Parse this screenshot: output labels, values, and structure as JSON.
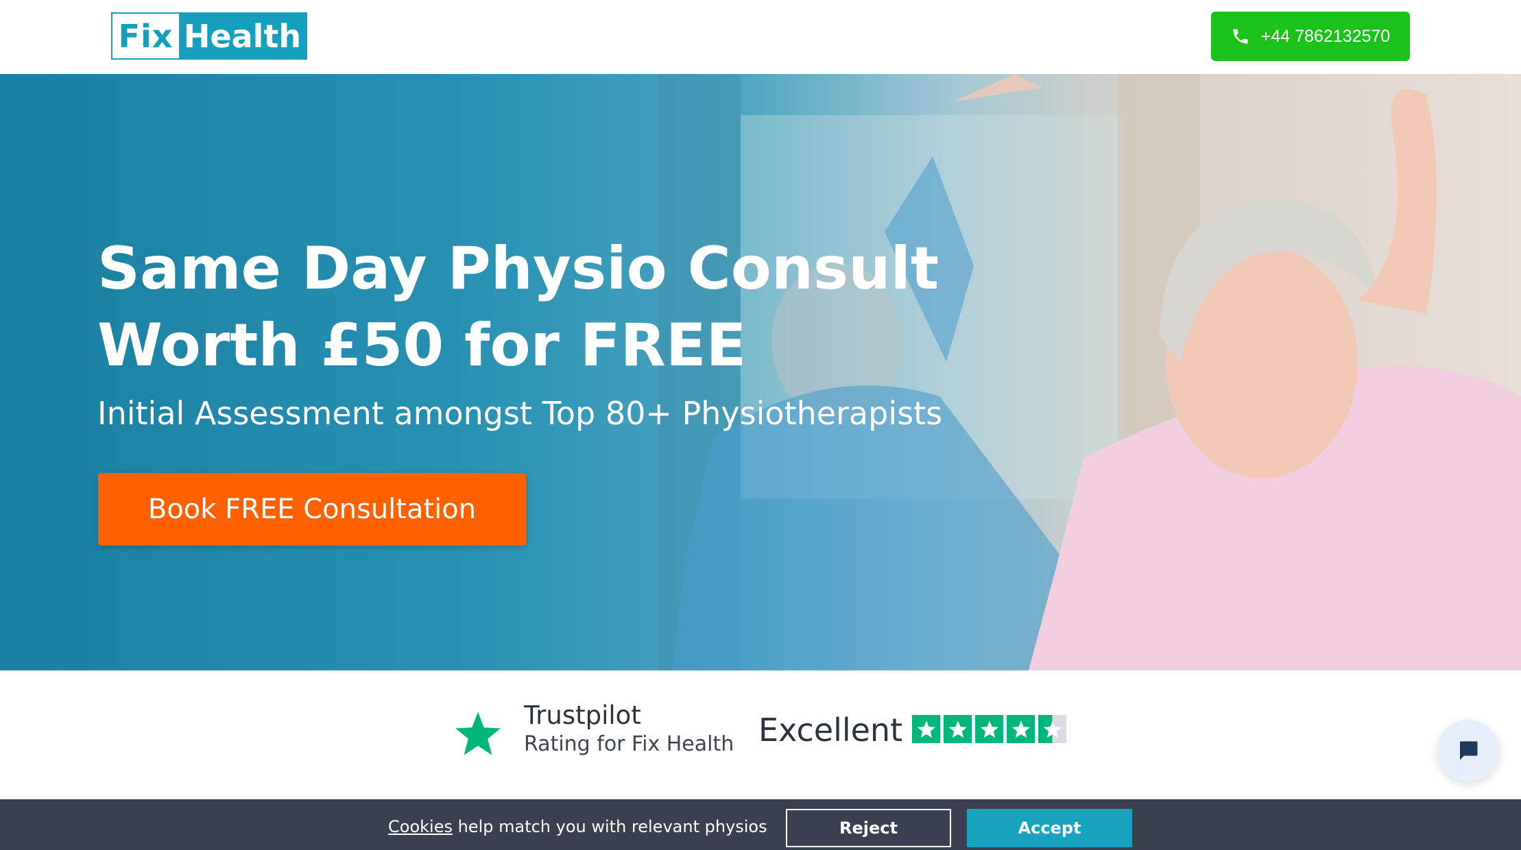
{
  "header": {
    "logo": {
      "fix": "Fix",
      "health": "Health"
    },
    "phone": "+44 7862132570"
  },
  "hero": {
    "title_line1": "Same Day Physio Consult",
    "title_line2": "Worth £50 for FREE",
    "subtitle": "Initial Assessment amongst Top 80+ Physiotherapists",
    "cta_label": "Book FREE Consultation"
  },
  "trustpilot": {
    "name": "Trustpilot",
    "rating_text": "Rating for Fix Health",
    "excellent": "Excellent",
    "stars": 4.5,
    "star_color": "#00b67a"
  },
  "cookie": {
    "link": "Cookies",
    "text": " help match you with relevant physios",
    "reject": "Reject",
    "accept": "Accept"
  },
  "colors": {
    "brand": "#14a0bd",
    "phone_button": "#1cc21c",
    "cta": "#ff6000",
    "cookie_bar": "#3a4050"
  },
  "icons": {
    "phone": "phone-icon",
    "chat": "chat-bubble-icon",
    "trustpilot": "trustpilot-star-icon"
  }
}
